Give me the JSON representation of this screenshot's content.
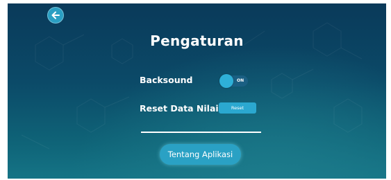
{
  "header": {
    "back_icon": "arrow-left-icon",
    "title": "Pengaturan"
  },
  "settings": {
    "backsound_label": "Backsound",
    "backsound_state": "ON",
    "backsound_on": true,
    "reset_label": "Reset Data Nilai",
    "reset_button_label": "Reset"
  },
  "about_button_label": "Tentang Aplikasi",
  "colors": {
    "background_top": "#0a3a5a",
    "background_bottom": "#157486",
    "accent": "#2aa1c4",
    "toggle_track": "#1a5f83",
    "text": "#ffffff"
  }
}
